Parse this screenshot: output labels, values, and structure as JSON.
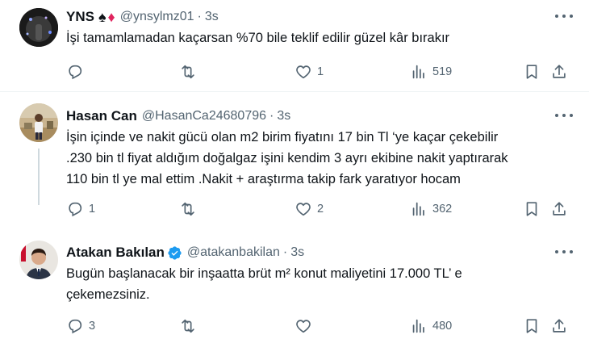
{
  "tweets": [
    {
      "name": "YNS",
      "handle": "@ynsylmz01",
      "time": "3s",
      "text_lines": [
        "İşi tamamlamadan kaçarsan %70 bile teklif edilir güzel kâr bırakır"
      ],
      "reply_count": "",
      "retweet_count": "",
      "like_count": "1",
      "view_count": "519"
    },
    {
      "name": "Hasan Can",
      "handle": "@HasanCa24680796",
      "time": "3s",
      "text_lines": [
        "İşin içinde ve nakit gücü olan m2 birim fiyatını 17 bin Tl ‘ye kaçar çekebilir",
        ".230 bin tl fiyat aldığım doğalgaz işini kendim 3 ayrı ekibine nakit yaptırarak",
        "110 bin tl ye mal ettim .Nakit + araştırma takip fark yaratıyor hocam"
      ],
      "reply_count": "1",
      "retweet_count": "",
      "like_count": "2",
      "view_count": "362"
    },
    {
      "name": "Atakan Bakılan",
      "handle": "@atakanbakilan",
      "time": "3s",
      "text_lines": [
        "Bugün başlanacak bir inşaatta brüt m² konut maliyetini 17.000 TL’ e",
        "çekemezsiniz."
      ],
      "reply_count": "3",
      "retweet_count": "",
      "like_count": "",
      "view_count": "480"
    }
  ],
  "separator_dot": "·",
  "colors": {
    "text": "#0f1419",
    "secondary": "#536471",
    "verified": "#1d9bf0",
    "divider": "#eff3f4",
    "suit_red": "#e0245e"
  },
  "icons": {
    "reply": "reply-icon",
    "retweet": "retweet-icon",
    "like": "heart-icon",
    "views": "views-icon",
    "bookmark": "bookmark-icon",
    "share": "share-icon",
    "more": "more-icon",
    "verified": "verified-badge-icon",
    "spade": "♠",
    "diamond": "♦"
  }
}
